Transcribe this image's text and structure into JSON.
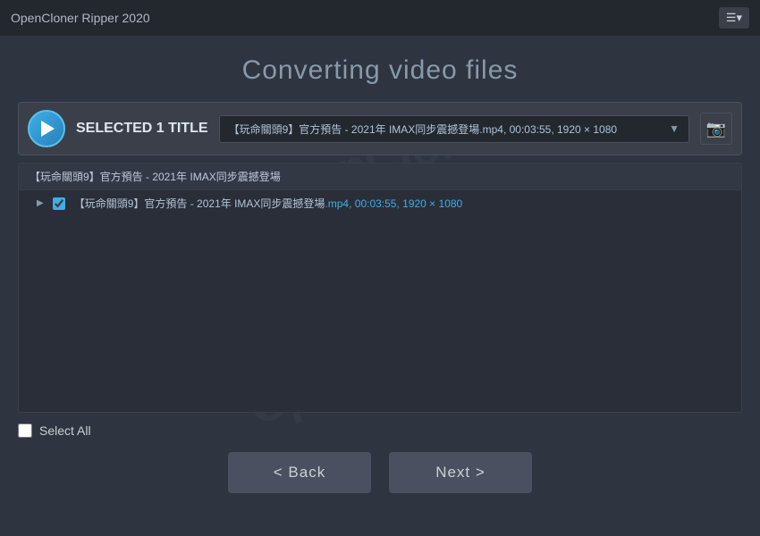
{
  "titlebar": {
    "title": "OpenCloner Ripper 2020",
    "menu_label": "☰▾"
  },
  "page": {
    "heading": "Converting video files"
  },
  "selected_title": {
    "label": "SELECTED 1 TITLE",
    "dropdown_text": "【玩命關頭9】官方預告 - 2021年 IMAX同步震撼登場.mp4, 00:03:55, 1920 × 1080",
    "camera_icon": "📷"
  },
  "file_list": {
    "header": "【玩命關頭9】官方預告 - 2021年 IMAX同步震撼登場",
    "items": [
      {
        "checked": true,
        "text_plain": "【玩命關頭9】官方預告 - 2021年 IMAX同步震撼登場",
        "text_highlight": ".mp4, 00:03:55, 1920 × 1080"
      }
    ]
  },
  "bottom": {
    "select_all_label": "Select All",
    "select_all_checked": false
  },
  "buttons": {
    "back_label": "<  Back",
    "next_label": "Next  >"
  }
}
